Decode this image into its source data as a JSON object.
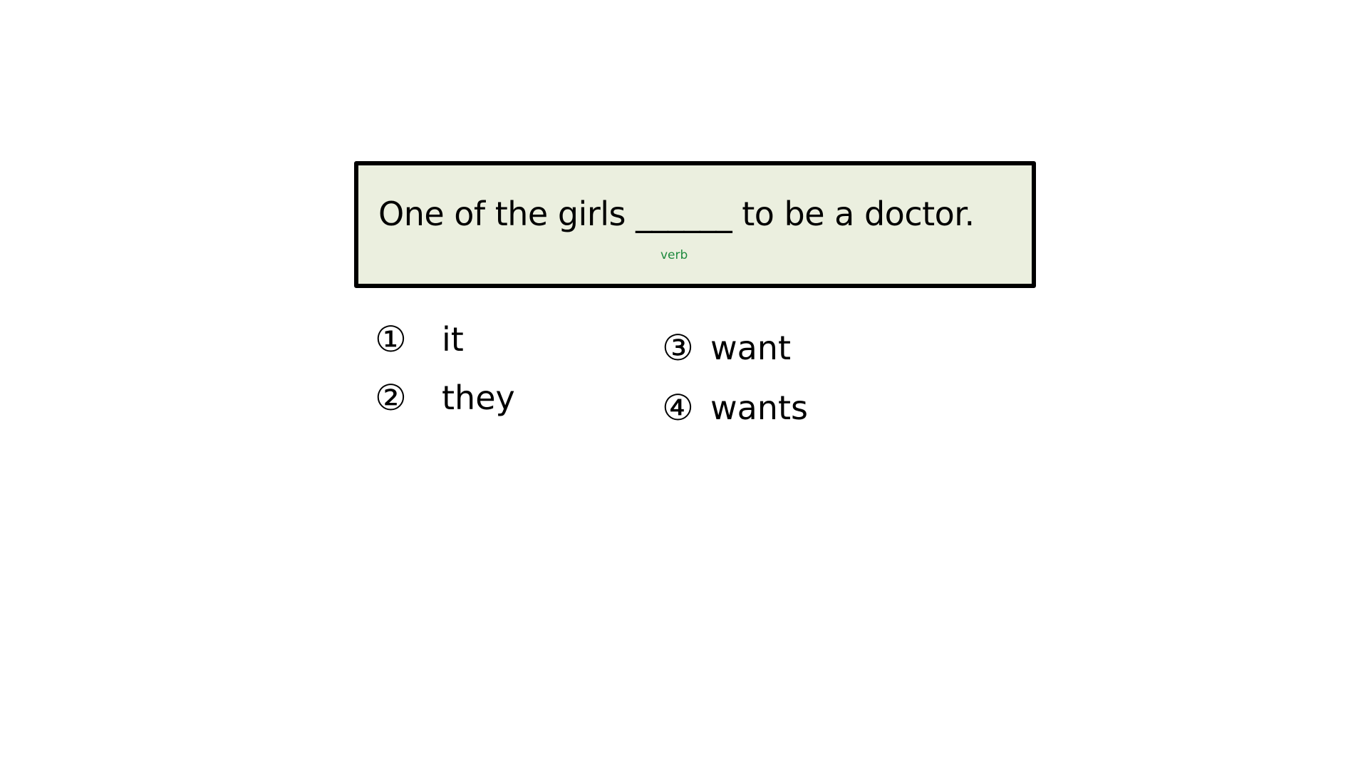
{
  "question": {
    "sentence": "One of the girls ______ to be a doctor.",
    "hint": "verb",
    "hint_color": "#1e8a3e",
    "box_background": "#ebefdf"
  },
  "options": [
    {
      "number": "①",
      "text": "it"
    },
    {
      "number": "②",
      "text": "they"
    },
    {
      "number": "③",
      "text": "want"
    },
    {
      "number": "④",
      "text": "wants"
    }
  ]
}
